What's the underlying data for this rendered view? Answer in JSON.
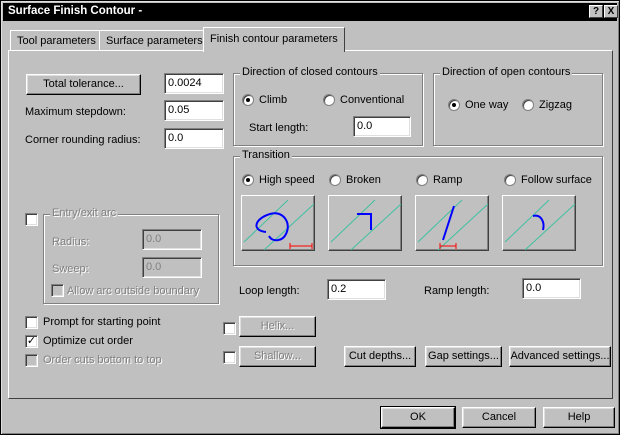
{
  "window": {
    "title": "Surface Finish Contour -",
    "help_glyph": "?",
    "close_glyph": "X"
  },
  "tabs": [
    {
      "label": "Tool parameters"
    },
    {
      "label": "Surface parameters"
    },
    {
      "label": "Finish contour parameters",
      "active": true
    }
  ],
  "left": {
    "total_tolerance_button": "Total tolerance...",
    "total_tolerance_value": "0.0024",
    "max_stepdown_label": "Maximum stepdown:",
    "max_stepdown_value": "0.05",
    "corner_rounding_label": "Corner rounding radius:",
    "corner_rounding_value": "0.0"
  },
  "closed_contours": {
    "title": "Direction of closed contours",
    "option_climb": "Climb",
    "option_conventional": "Conventional",
    "selected": "Climb",
    "start_length_label": "Start length:",
    "start_length_value": "0.0"
  },
  "open_contours": {
    "title": "Direction of open contours",
    "option_one_way": "One way",
    "option_zigzag": "Zigzag",
    "selected": "One way"
  },
  "transition": {
    "title": "Transition",
    "options": [
      "High speed",
      "Broken",
      "Ramp",
      "Follow surface"
    ],
    "selected": "High speed"
  },
  "entry_exit": {
    "title": "Entry/exit arc",
    "checked": false,
    "radius_label": "Radius:",
    "radius_value": "0.0",
    "sweep_label": "Sweep:",
    "sweep_value": "0.0",
    "allow_arc_label": "Allow arc outside boundary",
    "allow_arc_checked": false
  },
  "loop_length": {
    "label": "Loop length:",
    "value": "0.2"
  },
  "ramp_length": {
    "label": "Ramp length:",
    "value": "0.0"
  },
  "options": {
    "prompt_starting_point": "Prompt for starting point",
    "prompt_checked": false,
    "optimize_cut_order": "Optimize cut order",
    "optimize_checked": true,
    "order_bottom_top": "Order cuts bottom to top",
    "order_checked": false
  },
  "buttons": {
    "helix": "Helix...",
    "helix_checked": false,
    "shallow": "Shallow...",
    "shallow_checked": false,
    "cut_depths": "Cut depths...",
    "gap_settings": "Gap settings...",
    "advanced_settings": "Advanced settings..."
  },
  "footer": {
    "ok": "OK",
    "cancel": "Cancel",
    "help": "Help"
  },
  "colors": {
    "path_blue": "#0000ff",
    "guide_cyan": "#40c0a0",
    "marker_red": "#ff0000"
  }
}
